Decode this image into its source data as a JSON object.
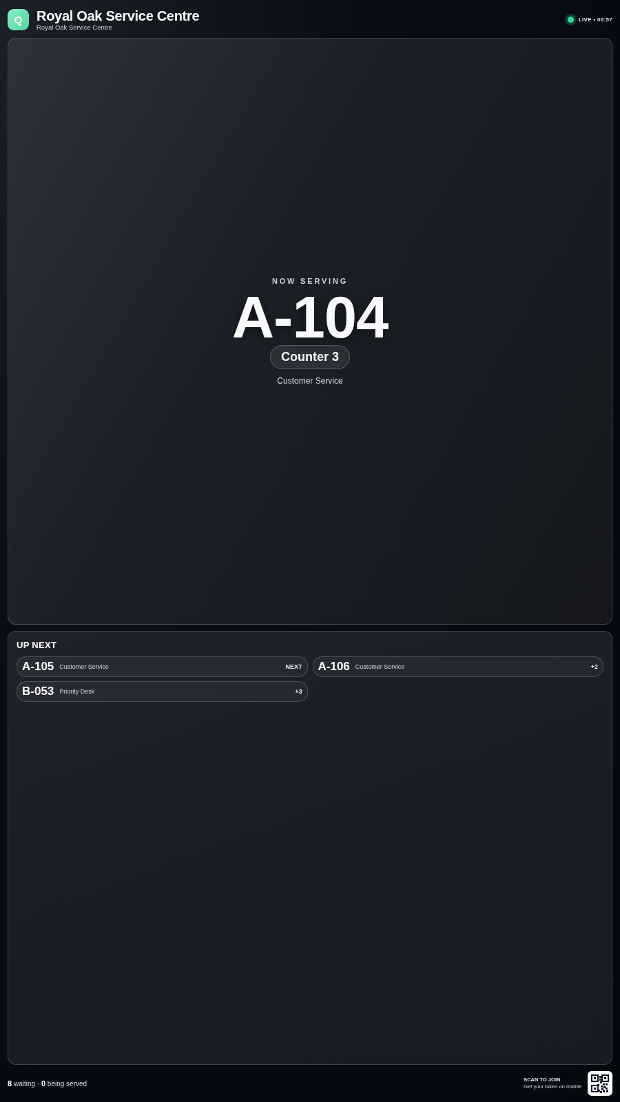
{
  "header": {
    "logo_letter": "Q",
    "title": "Royal Oak Service Centre",
    "subtitle": "Royal Oak Service Centre",
    "status": {
      "text": "LIVE • 00:57",
      "live": true
    }
  },
  "now_serving": {
    "heading": "NOW SERVING",
    "token": "A-104",
    "counter": "Counter 3",
    "service": "Customer Service"
  },
  "up_next": {
    "heading": "UP NEXT",
    "items": [
      {
        "token": "A-105",
        "service": "Customer Service",
        "position": "NEXT"
      },
      {
        "token": "A-106",
        "service": "Customer Service",
        "position": "+2"
      },
      {
        "token": "B-053",
        "service": "Priority Desk",
        "position": "+3"
      }
    ]
  },
  "footer": {
    "stats": "**8** waiting · **0** being served",
    "scan_title": "SCAN TO JOIN",
    "scan_subtitle": "Get your token on mobile"
  }
}
